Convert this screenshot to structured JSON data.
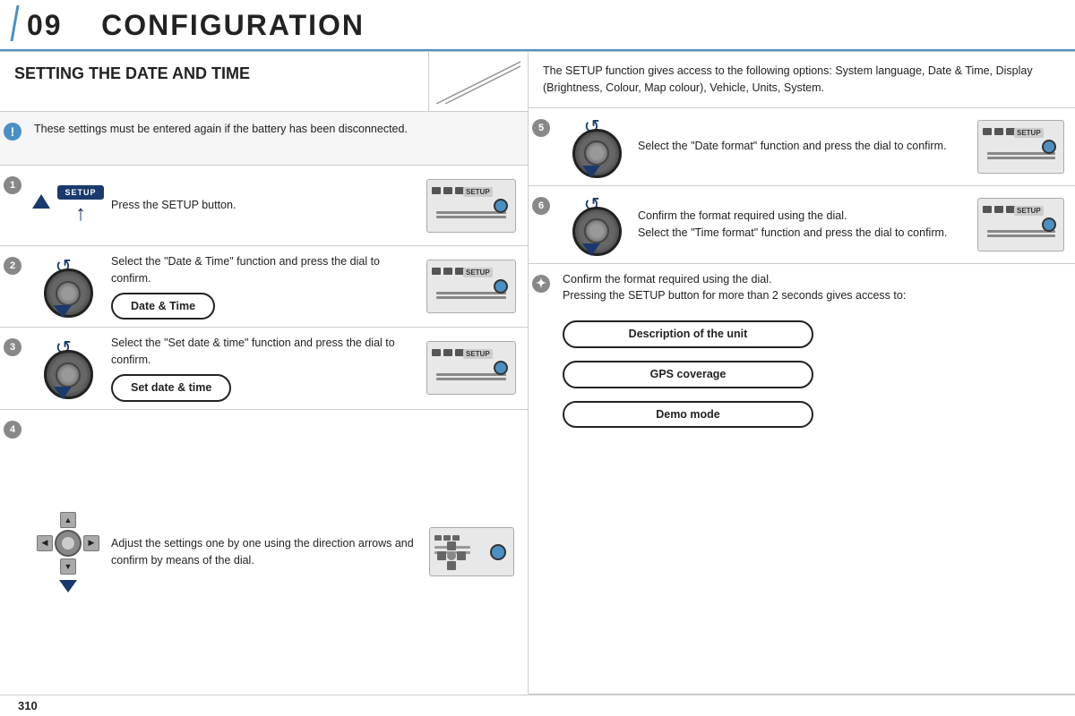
{
  "header": {
    "chapter": "09",
    "title": "CONFIGURATION"
  },
  "left": {
    "section_title": "SETTING THE DATE AND TIME",
    "alert_text": "These settings must be entered again if the battery has been disconnected.",
    "steps": [
      {
        "num": "1",
        "text": "Press the SETUP button.",
        "icon_type": "setup"
      },
      {
        "num": "2",
        "text": "Select the \"Date & Time\" function and press the dial to confirm.",
        "pill": "Date & Time",
        "icon_type": "dial"
      },
      {
        "num": "3",
        "text": "Select the \"Set date & time\" function and press the dial to confirm.",
        "pill": "Set date & time",
        "icon_type": "dial"
      },
      {
        "num": "4",
        "text": "Adjust the settings one by one using the direction arrows and confirm by means of the dial.",
        "icon_type": "dpad"
      }
    ]
  },
  "right": {
    "section_desc": "The SETUP function gives access to the following options: System language, Date & Time, Display (Brightness, Colour, Map colour), Vehicle, Units, System.",
    "steps": [
      {
        "num": "5",
        "text": "Select the \"Date format\" function and press the dial to confirm.",
        "icon_type": "dial"
      },
      {
        "num": "6",
        "text_line1": "Confirm the format required using the dial.",
        "text_line2": "Select the \"Time format\" function and press the dial to confirm.",
        "icon_type": "dial"
      }
    ],
    "sun_step": {
      "text_line1": "Confirm the format required using the dial.",
      "text_line2": "Pressing the SETUP button for more than 2 seconds gives access to:",
      "pills": [
        "Description of the unit",
        "GPS coverage",
        "Demo mode"
      ]
    }
  },
  "footer": {
    "page_number": "310"
  }
}
